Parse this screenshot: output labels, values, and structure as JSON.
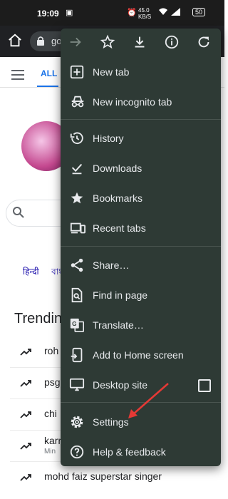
{
  "status": {
    "time": "19:09",
    "net": "45.0",
    "net_unit": "KB/S",
    "battery": "50"
  },
  "toolbar": {
    "url": "go"
  },
  "page": {
    "tab_all": "ALL",
    "langs": [
      "हिन्दी",
      "বাং"
    ],
    "trending_title": "Trending",
    "trends": [
      {
        "title": "roh",
        "sub": ""
      },
      {
        "title": "psg",
        "sub": ""
      },
      {
        "title": "chi",
        "sub": ""
      },
      {
        "title": "karr",
        "sub": "Min"
      },
      {
        "title": "mohd faiz superstar singer",
        "sub": ""
      }
    ]
  },
  "menu": {
    "items": [
      {
        "label": "New tab",
        "icon": "new-tab-icon"
      },
      {
        "label": "New incognito tab",
        "icon": "incognito-icon"
      },
      {
        "label": "History",
        "icon": "history-icon"
      },
      {
        "label": "Downloads",
        "icon": "downloads-icon"
      },
      {
        "label": "Bookmarks",
        "icon": "bookmarks-icon"
      },
      {
        "label": "Recent tabs",
        "icon": "recent-tabs-icon"
      },
      {
        "label": "Share…",
        "icon": "share-icon"
      },
      {
        "label": "Find in page",
        "icon": "find-in-page-icon"
      },
      {
        "label": "Translate…",
        "icon": "translate-icon"
      },
      {
        "label": "Add to Home screen",
        "icon": "add-to-home-icon"
      },
      {
        "label": "Desktop site",
        "icon": "desktop-icon"
      },
      {
        "label": "Settings",
        "icon": "settings-icon"
      },
      {
        "label": "Help & feedback",
        "icon": "help-icon"
      }
    ]
  },
  "colors": {
    "menu_bg": "#2e3a35",
    "accent": "#1a73e8",
    "arrow": "#e53935"
  }
}
